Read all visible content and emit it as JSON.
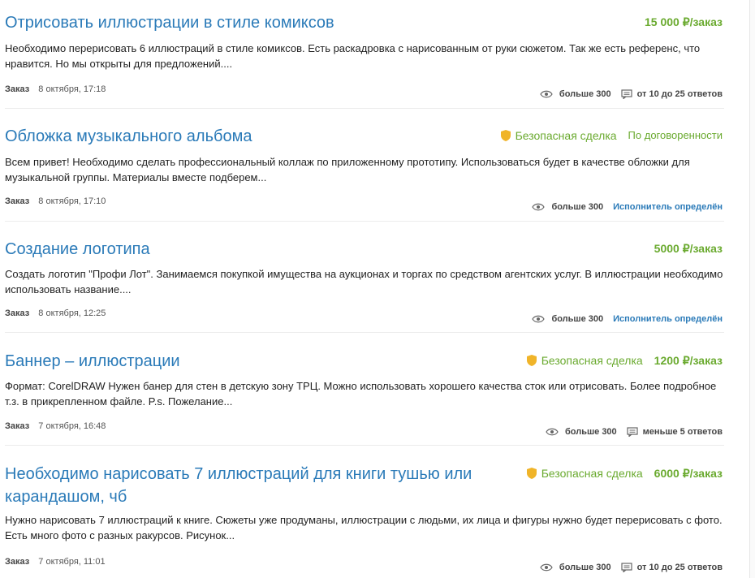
{
  "colors": {
    "link": "#2a7ab8",
    "price": "#6aaa2f",
    "shield": "#f0b429"
  },
  "orders": [
    {
      "title": "Отрисовать иллюстрации в стиле комиксов",
      "safe_deal": "",
      "price": "15 000 ₽/заказ",
      "description": "Необходимо перерисовать 6 иллюстраций в стиле комиксов. Есть раскадровка с нарисованным от руки сюжетом. Так же есть референс, что нравится. Но мы открыты для предложений....",
      "type": "Заказ",
      "date": "8 октября, 17:18",
      "views": "больше 300",
      "responses": "от 10 до 25 ответов",
      "status": ""
    },
    {
      "title": "Обложка музыкального альбома",
      "safe_deal": "Безопасная сделка",
      "price": "По договоренности",
      "description": "Всем привет! Необходимо сделать профессиональный коллаж по приложенному прототипу. Использоваться будет в качестве обложки для музыкальной группы. Материалы вместе подберем...",
      "type": "Заказ",
      "date": "8 октября, 17:10",
      "views": "больше 300",
      "responses": "",
      "status": "Исполнитель определён"
    },
    {
      "title": "Создание логотипа",
      "safe_deal": "",
      "price": "5000 ₽/заказ",
      "description": "Создать логотип \"Профи Лот\". Занимаемся покупкой имущества на аукционах и торгах по средством агентских услуг. В иллюстрации необходимо использовать название....",
      "type": "Заказ",
      "date": "8 октября, 12:25",
      "views": "больше 300",
      "responses": "",
      "status": "Исполнитель определён"
    },
    {
      "title": "Баннер – иллюстрации",
      "safe_deal": "Безопасная сделка",
      "price": "1200 ₽/заказ",
      "description": "Формат: CorelDRAW Нужен банер для стен в детскую зону ТРЦ. Можно использовать хорошего качества сток или отрисовать. Более подробное т.з. в прикрепленном файле. P.s. Пожелание...",
      "type": "Заказ",
      "date": "7 октября, 16:48",
      "views": "больше 300",
      "responses": "меньше 5 ответов",
      "status": ""
    },
    {
      "title": "Необходимо нарисовать 7 иллюстраций для книги тушью или карандашом, чб",
      "safe_deal": "Безопасная сделка",
      "price": "6000 ₽/заказ",
      "description": "Нужно нарисовать 7 иллюстраций к книге. Сюжеты уже продуманы, иллюстрации с людьми, их лица и фигуры нужно будет перерисовать с фото. Есть много фото с разных ракурсов. Рисунок...",
      "type": "Заказ",
      "date": "7 октября, 11:01",
      "views": "больше 300",
      "responses": "от 10 до 25 ответов",
      "status": ""
    }
  ]
}
